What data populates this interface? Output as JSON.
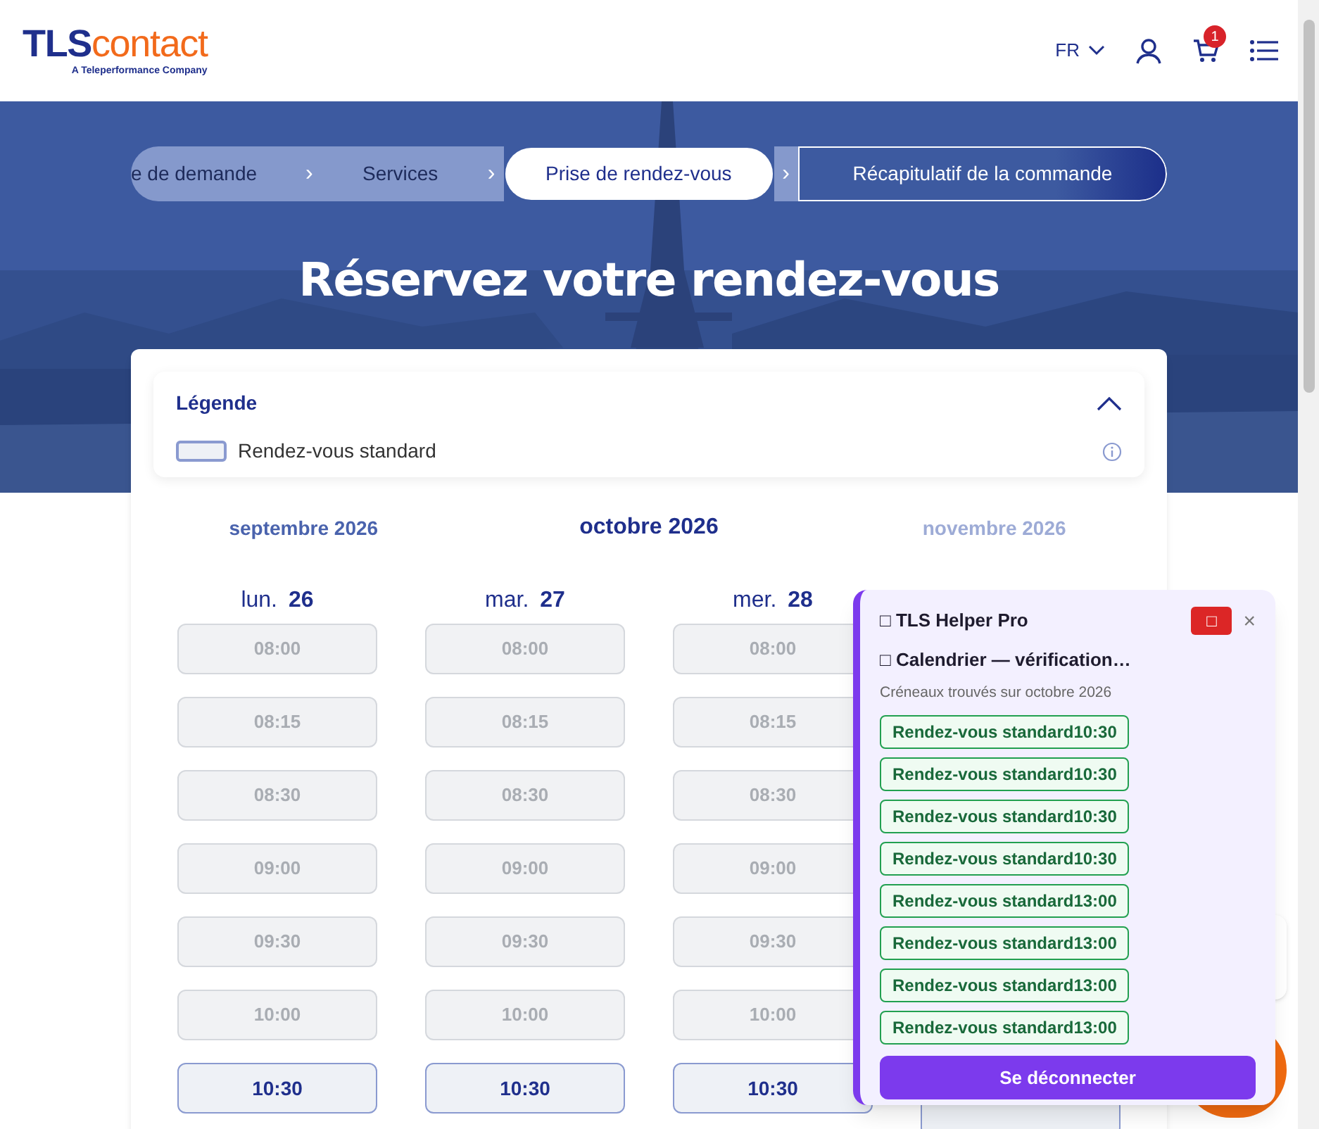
{
  "header": {
    "logo": {
      "brand_bold": "TLS",
      "brand_light": "contact",
      "tagline": "A Teleperformance Company"
    },
    "language": "FR",
    "cart_count": "1"
  },
  "steps": [
    {
      "label": "e de demande",
      "selected": false
    },
    {
      "label": "Services",
      "selected": false
    },
    {
      "label": "Prise de rendez-vous",
      "selected": true
    },
    {
      "label": "Récapitulatif de la commande",
      "selected": false
    }
  ],
  "separators": [
    "›",
    "›",
    "›"
  ],
  "title": "Réservez votre rendez-vous",
  "legend": {
    "title": "Légende",
    "expanded": true,
    "items": [
      {
        "label": "Rendez-vous standard"
      }
    ]
  },
  "months": [
    {
      "label": "septembre 2026",
      "selected": false,
      "disabled": false
    },
    {
      "label": "octobre 2026",
      "selected": true,
      "disabled": false
    },
    {
      "label": "novembre 2026",
      "selected": false,
      "disabled": true
    }
  ],
  "days": [
    {
      "weekday": "lun.",
      "date": "26",
      "slots": [
        {
          "time": "08:00",
          "available": false
        },
        {
          "time": "08:15",
          "available": false
        },
        {
          "time": "08:30",
          "available": false
        },
        {
          "time": "09:00",
          "available": false
        },
        {
          "time": "09:30",
          "available": false
        },
        {
          "time": "10:00",
          "available": false
        },
        {
          "time": "10:30",
          "available": true
        }
      ]
    },
    {
      "weekday": "mar.",
      "date": "27",
      "slots": [
        {
          "time": "08:00",
          "available": false
        },
        {
          "time": "08:15",
          "available": false
        },
        {
          "time": "08:30",
          "available": false
        },
        {
          "time": "09:00",
          "available": false
        },
        {
          "time": "09:30",
          "available": false
        },
        {
          "time": "10:00",
          "available": false
        },
        {
          "time": "10:30",
          "available": true
        }
      ]
    },
    {
      "weekday": "mer.",
      "date": "28",
      "slots": [
        {
          "time": "08:00",
          "available": false
        },
        {
          "time": "08:15",
          "available": false
        },
        {
          "time": "08:30",
          "available": false
        },
        {
          "time": "09:00",
          "available": false
        },
        {
          "time": "09:30",
          "available": false
        },
        {
          "time": "10:00",
          "available": false
        },
        {
          "time": "10:30",
          "available": true
        }
      ]
    }
  ],
  "helper": {
    "title": "□ TLS Helper Pro",
    "stop_button": "□",
    "close": "×",
    "status": "□ Calendrier — vérification…",
    "subtitle": "Créneaux trouvés sur octobre 2026",
    "results": [
      "Rendez-vous standard10:30",
      "Rendez-vous standard10:30",
      "Rendez-vous standard10:30",
      "Rendez-vous standard10:30",
      "Rendez-vous standard13:00",
      "Rendez-vous standard13:00",
      "Rendez-vous standard13:00",
      "Rendez-vous standard13:00"
    ],
    "logout": "Se déconnecter"
  }
}
